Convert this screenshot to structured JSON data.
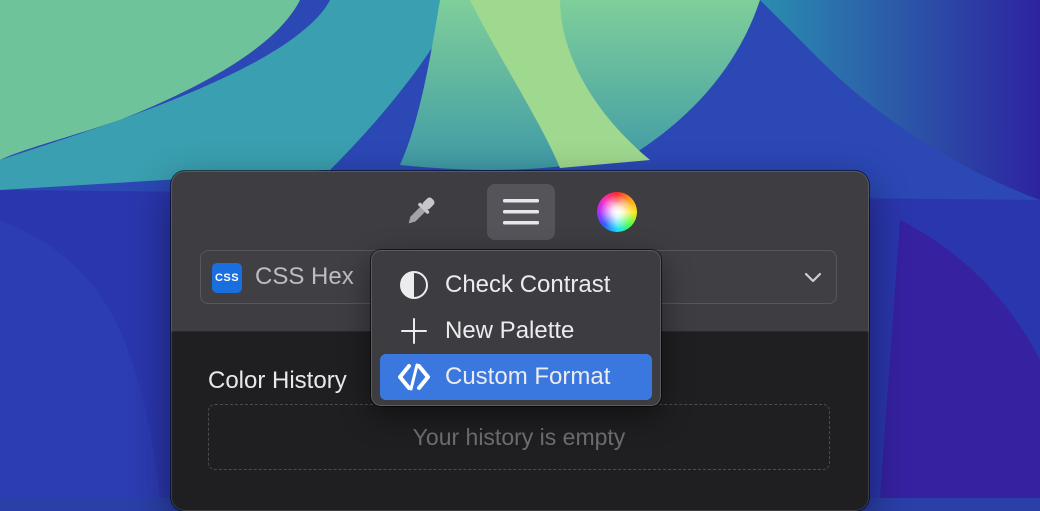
{
  "toolbar": {
    "buttons": [
      {
        "icon": "eyedropper-icon"
      },
      {
        "icon": "hamburger-menu-icon",
        "active": true
      },
      {
        "icon": "color-wheel-icon"
      }
    ]
  },
  "format_select": {
    "badge": "CSS",
    "label": "CSS Hex",
    "badge_color": "#1a6fe0"
  },
  "history": {
    "title": "Color History",
    "empty_text": "Your history is empty"
  },
  "menu": {
    "items": [
      {
        "label": "Check Contrast",
        "icon": "contrast-icon"
      },
      {
        "label": "New Palette",
        "icon": "plus-icon"
      },
      {
        "label": "Custom Format",
        "icon": "code-icon",
        "selected": true
      }
    ],
    "accent": "#3a78e0"
  }
}
